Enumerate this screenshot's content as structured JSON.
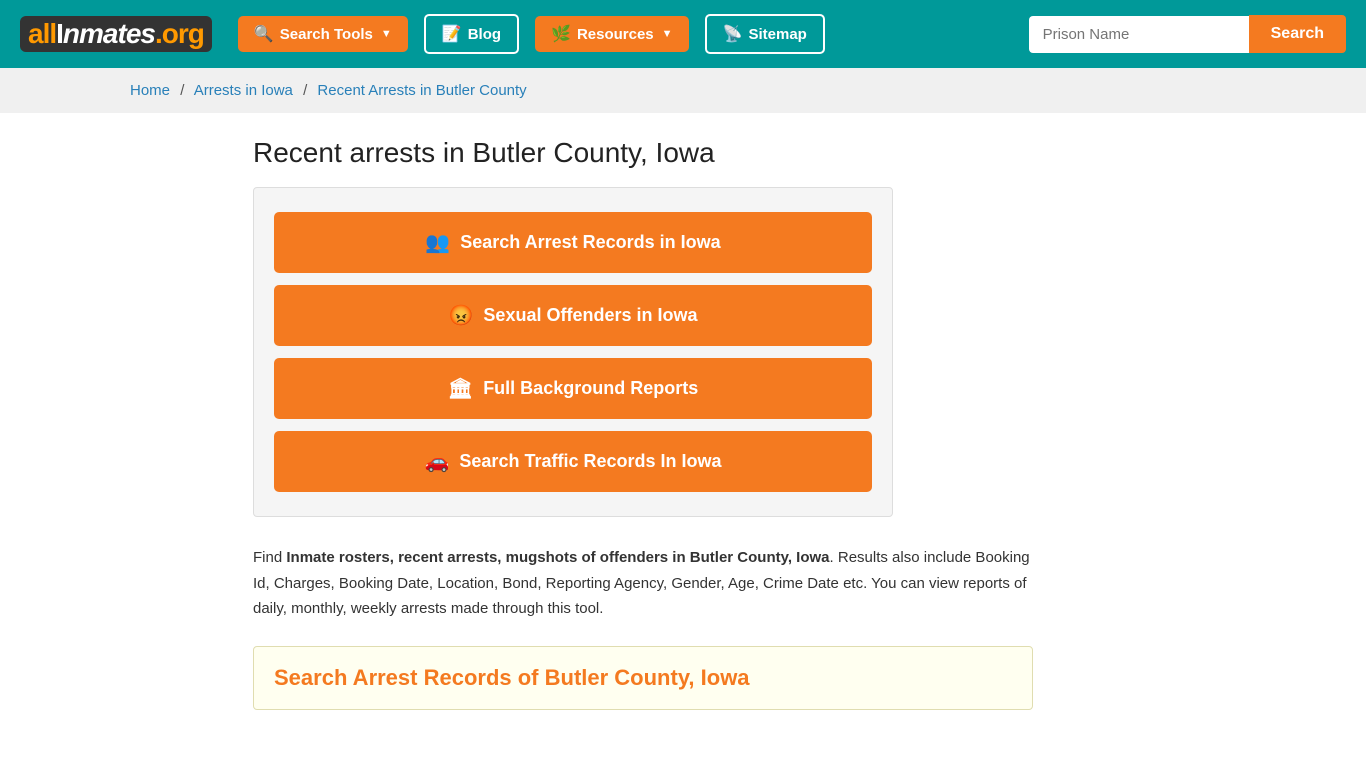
{
  "header": {
    "logo": {
      "all": "all",
      "inmates": "Inmates",
      "org": ".org"
    },
    "nav": [
      {
        "id": "search-tools",
        "label": "Search Tools",
        "icon": "🔍",
        "hasDropdown": true
      },
      {
        "id": "blog",
        "label": "Blog",
        "icon": "📝",
        "hasDropdown": false
      },
      {
        "id": "resources",
        "label": "Resources",
        "icon": "🌿",
        "hasDropdown": true
      },
      {
        "id": "sitemap",
        "label": "Sitemap",
        "icon": "📡",
        "hasDropdown": false
      }
    ],
    "search_placeholder": "Prison Name",
    "search_label": "Search"
  },
  "breadcrumb": {
    "home": "Home",
    "arrests_iowa": "Arrests in Iowa",
    "current": "Recent Arrests in Butler County"
  },
  "page": {
    "title": "Recent arrests in Butler County, Iowa",
    "buttons": [
      {
        "id": "arrest-records",
        "icon": "👥",
        "label": "Search Arrest Records in Iowa"
      },
      {
        "id": "sexual-offenders",
        "icon": "😡",
        "label": "Sexual Offenders in Iowa"
      },
      {
        "id": "background-reports",
        "icon": "🏛",
        "label": "Full Background Reports"
      },
      {
        "id": "traffic-records",
        "icon": "🚗",
        "label": "Search Traffic Records In Iowa"
      }
    ],
    "description": {
      "prefix": "Find ",
      "bold": "Inmate rosters, recent arrests, mugshots of offenders in Butler County, Iowa",
      "suffix": ". Results also include Booking Id, Charges, Booking Date, Location, Bond, Reporting Agency, Gender, Age, Crime Date etc. You can view reports of daily, monthly, weekly arrests made through this tool."
    },
    "search_section_title": "Search Arrest Records of Butler County, Iowa"
  }
}
